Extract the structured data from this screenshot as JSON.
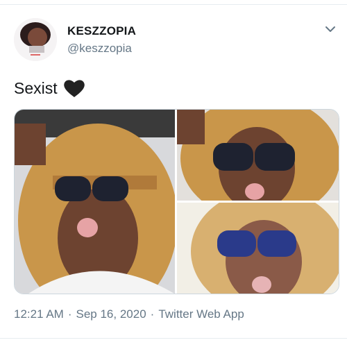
{
  "tweet": {
    "display_name": "KESZZOPIA",
    "handle": "@keszzopia",
    "text": "Sexist",
    "emoji": "black-heart-icon",
    "time": "12:21 AM",
    "date": "Sep 16, 2020",
    "separator": "·",
    "source": "Twitter Web App"
  },
  "media": {
    "photo_count": 3,
    "photos": [
      "selfie-photo-1",
      "selfie-photo-2",
      "selfie-photo-3"
    ]
  },
  "colors": {
    "text": "#14171a",
    "secondary_text": "#657786",
    "border": "#ccd6dd",
    "hair": "#c9964a",
    "lens": "#2a3a6a"
  }
}
